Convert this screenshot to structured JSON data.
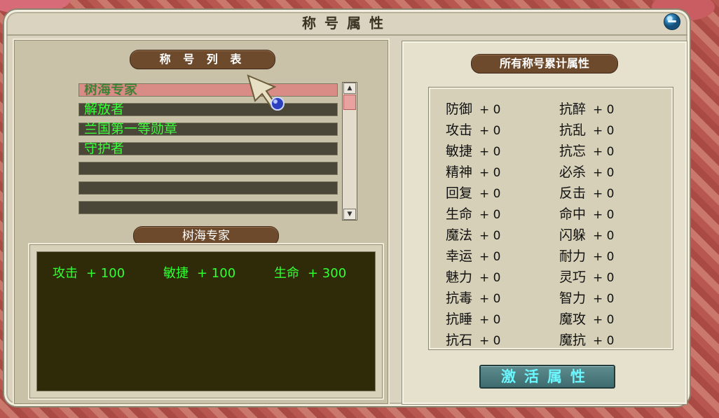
{
  "window": {
    "title": "称号属性"
  },
  "list_section": {
    "header": "称 号 列 表",
    "items": [
      {
        "label": "树海专家",
        "selected": true
      },
      {
        "label": "解放者",
        "selected": false
      },
      {
        "label": "兰国第一等勋章",
        "selected": false
      },
      {
        "label": "守护者",
        "selected": false
      },
      {
        "label": "",
        "selected": false
      },
      {
        "label": "",
        "selected": false
      },
      {
        "label": "",
        "selected": false
      }
    ],
    "selected_title": "树海专家"
  },
  "selected_bonuses": [
    {
      "name": "攻击",
      "value": "+ 100"
    },
    {
      "name": "敏捷",
      "value": "+ 100"
    },
    {
      "name": "生命",
      "value": "+ 300"
    }
  ],
  "totals_section": {
    "header": "所有称号累计属性",
    "left": [
      {
        "name": "防御",
        "value": "+ 0"
      },
      {
        "name": "攻击",
        "value": "+ 0"
      },
      {
        "name": "敏捷",
        "value": "+ 0"
      },
      {
        "name": "精神",
        "value": "+ 0"
      },
      {
        "name": "回复",
        "value": "+ 0"
      },
      {
        "name": "生命",
        "value": "+ 0"
      },
      {
        "name": "魔法",
        "value": "+ 0"
      },
      {
        "name": "幸运",
        "value": "+ 0"
      },
      {
        "name": "魅力",
        "value": "+ 0"
      },
      {
        "name": "抗毒",
        "value": "+ 0"
      },
      {
        "name": "抗睡",
        "value": "+ 0"
      },
      {
        "name": "抗石",
        "value": "+ 0"
      }
    ],
    "right": [
      {
        "name": "抗醉",
        "value": "+ 0"
      },
      {
        "name": "抗乱",
        "value": "+ 0"
      },
      {
        "name": "抗忘",
        "value": "+ 0"
      },
      {
        "name": "必杀",
        "value": "+ 0"
      },
      {
        "name": "反击",
        "value": "+ 0"
      },
      {
        "name": "命中",
        "value": "+ 0"
      },
      {
        "name": "闪躲",
        "value": "+ 0"
      },
      {
        "name": "耐力",
        "value": "+ 0"
      },
      {
        "name": "灵巧",
        "value": "+ 0"
      },
      {
        "name": "智力",
        "value": "+ 0"
      },
      {
        "name": "魔攻",
        "value": "+ 0"
      },
      {
        "name": "魔抗",
        "value": "+ 0"
      }
    ],
    "activate_label": "激活属性"
  },
  "icons": {
    "close": "minimize-icon",
    "cursor": "pointer-cursor-icon"
  },
  "colors": {
    "accent_green": "#33ff33",
    "selected_row": "#d98b86",
    "button_text": "#6cf7ff"
  }
}
